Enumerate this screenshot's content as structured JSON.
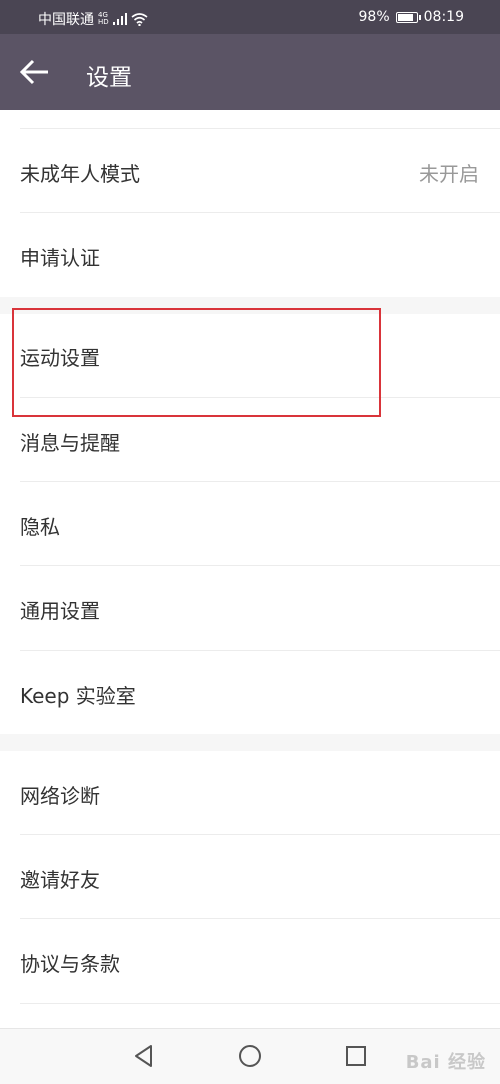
{
  "status_bar": {
    "carrier": "中国联通",
    "network": "4G",
    "network_sub": "HD",
    "battery": "98%",
    "battery_level": 0.98,
    "time": "08:19"
  },
  "app_bar": {
    "title": "设置"
  },
  "settings": [
    {
      "label": "未成年人模式",
      "value": "未开启"
    },
    {
      "label": "申请认证"
    },
    {
      "label": "运动设置"
    },
    {
      "label": "消息与提醒"
    },
    {
      "label": "隐私"
    },
    {
      "label": "通用设置"
    },
    {
      "label": "Keep 实验室"
    },
    {
      "label": "网络诊断"
    },
    {
      "label": "邀请好友"
    },
    {
      "label": "协议与条款"
    }
  ],
  "nav_bar": {
    "buttons": [
      "back-icon",
      "home-icon",
      "recents-icon"
    ]
  },
  "watermark": "Bai 经验"
}
